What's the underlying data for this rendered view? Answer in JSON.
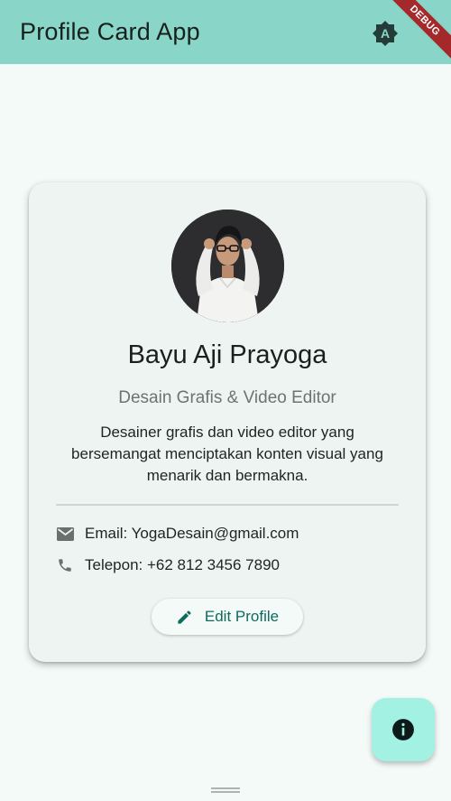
{
  "app_bar": {
    "title": "Profile Card App",
    "action_icon": "theme-toggle-icon",
    "action_letter": "A",
    "debug_banner": "DEBUG",
    "color": "#89d6c8"
  },
  "profile": {
    "avatar_icon": "profile-photo",
    "name": "Bayu Aji Prayoga",
    "role": "Desain Grafis & Video Editor",
    "bio": "Desainer grafis dan video editor yang bersemangat menciptakan konten visual yang menarik dan bermakna.",
    "contacts": [
      {
        "icon": "email-icon",
        "text": "Email: YogaDesain@gmail.com"
      },
      {
        "icon": "phone-icon",
        "text": "Telepon: +62 812 3456 7890"
      }
    ],
    "edit_button": {
      "icon": "edit-icon",
      "label": "Edit Profile"
    }
  },
  "fab": {
    "icon": "info-icon",
    "color": "#a3f1e2"
  },
  "colors": {
    "accent": "#0f6a5e",
    "card_background": "#eef4f2",
    "page_background": "#f4faf8"
  }
}
